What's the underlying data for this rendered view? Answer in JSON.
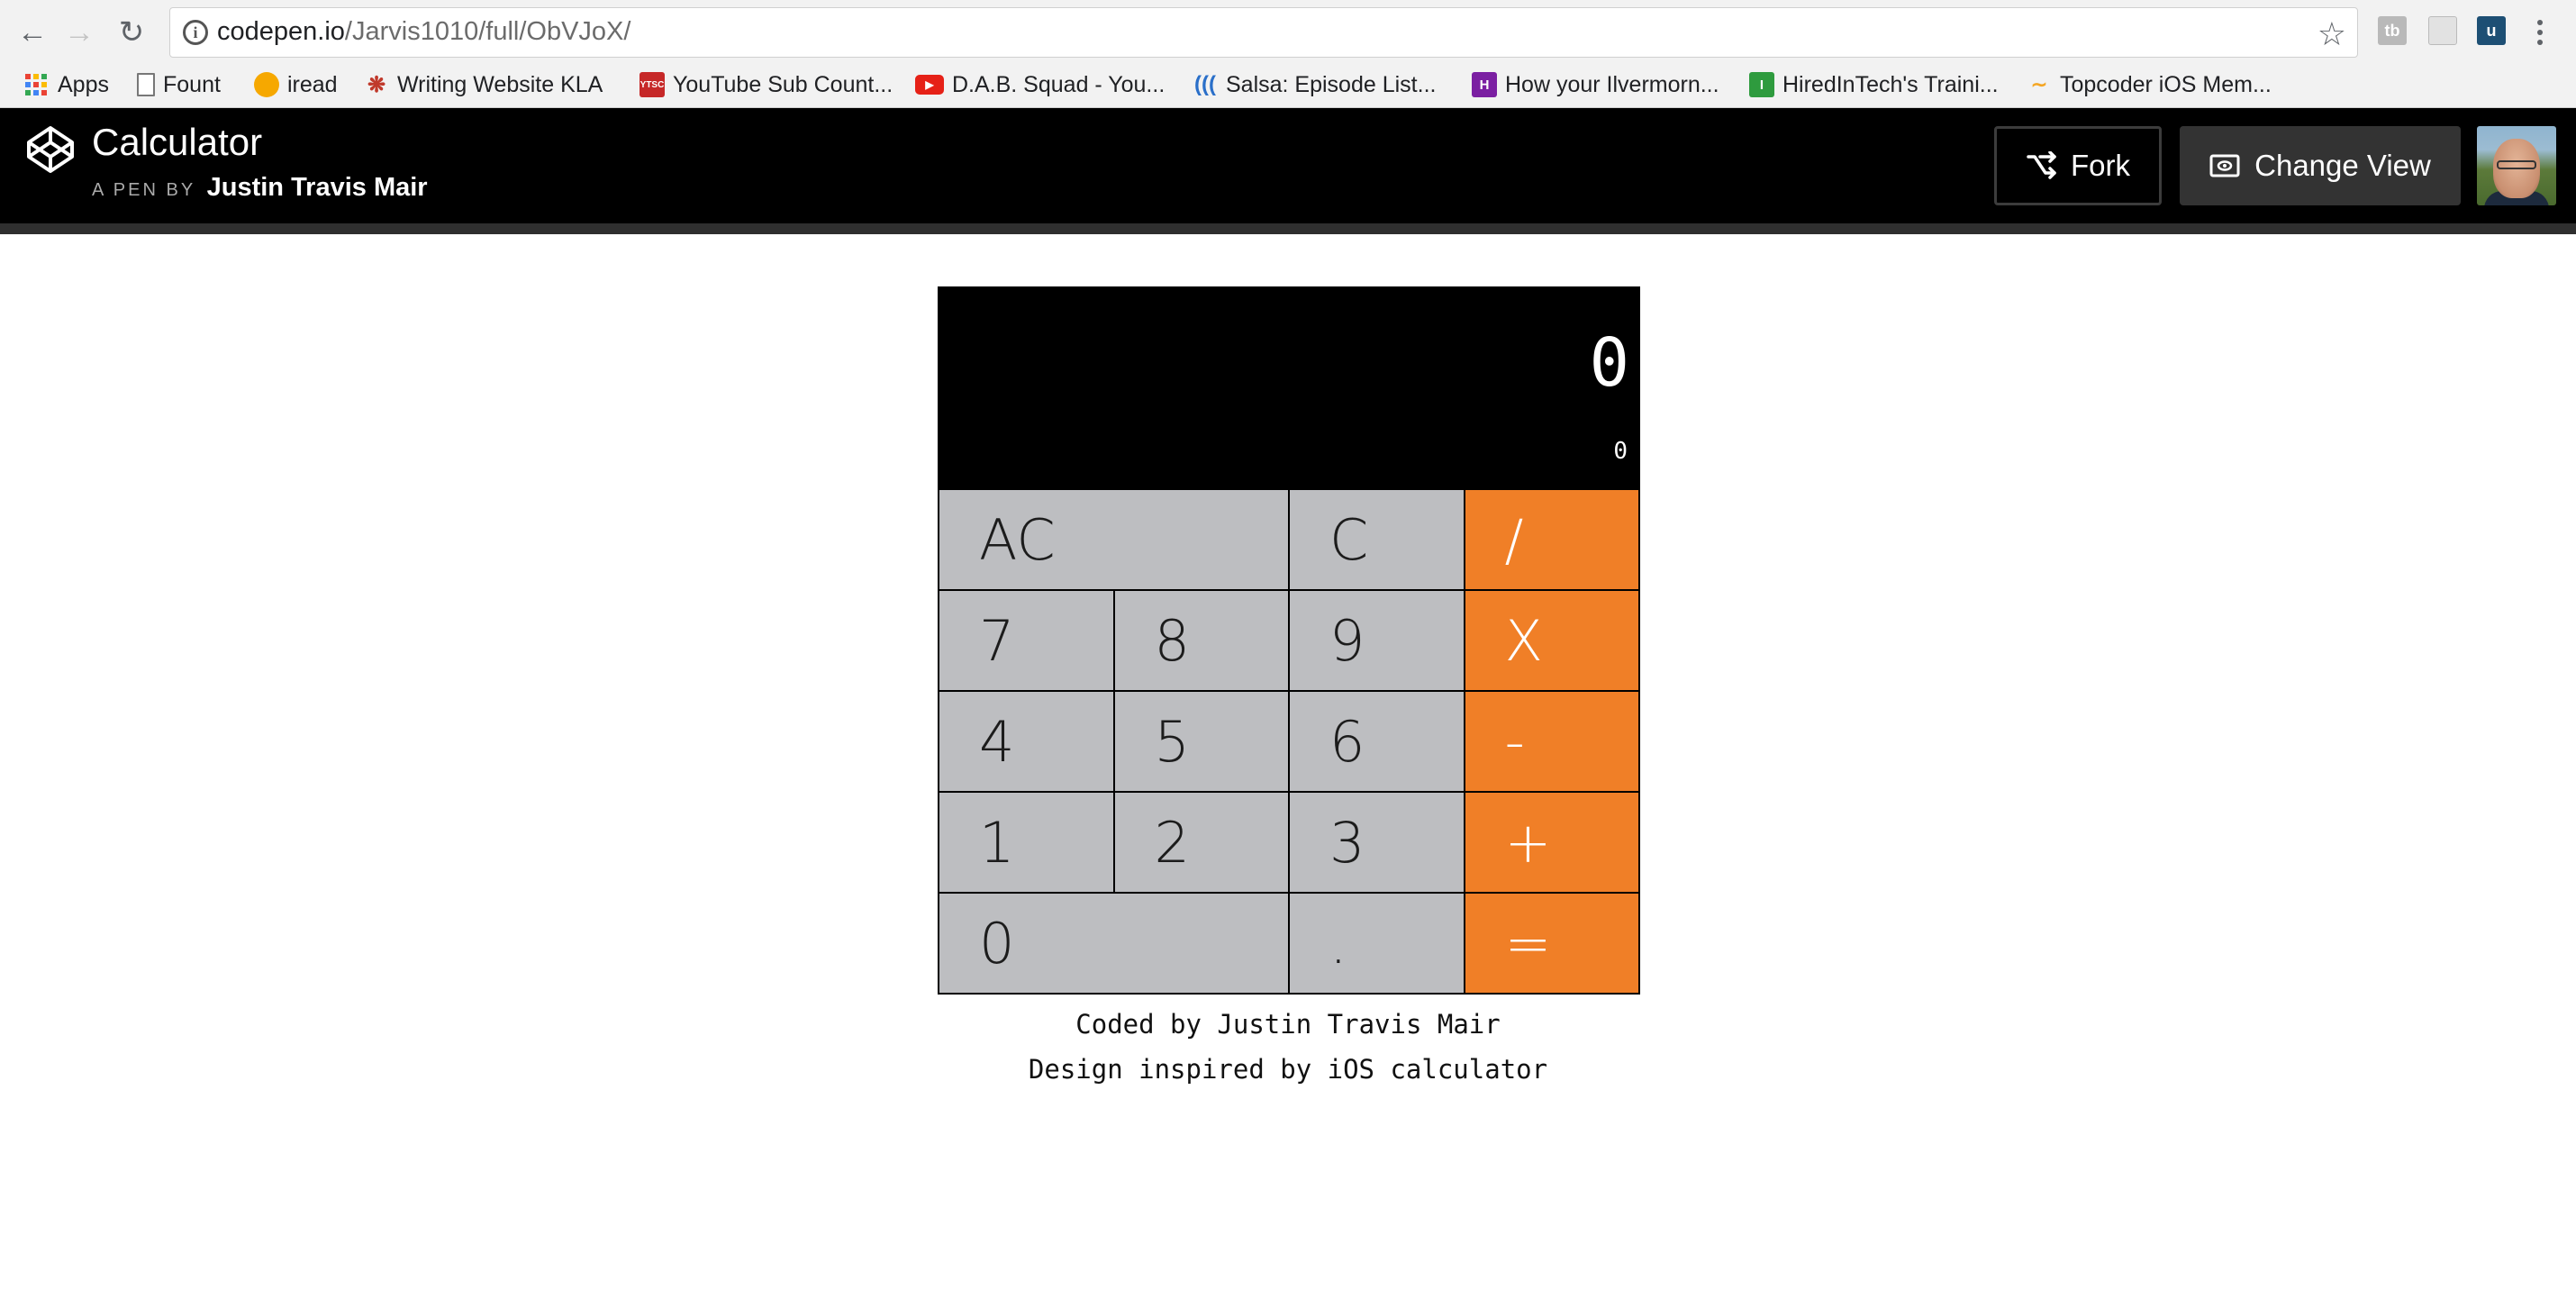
{
  "browser": {
    "url_host": "codepen.io",
    "url_path": "/Jarvis1010/full/ObVJoX/",
    "bookmarks": [
      {
        "label": "Apps",
        "icon": "apps-grid-icon"
      },
      {
        "label": "Fount",
        "icon": "page-icon"
      },
      {
        "label": "iread",
        "icon": "orange-dot-icon"
      },
      {
        "label": "Writing Website KLA",
        "icon": "bug-icon"
      },
      {
        "label": "YouTube Sub Count...",
        "icon": "ytsc-icon"
      },
      {
        "label": "D.A.B. Squad - You...",
        "icon": "youtube-icon"
      },
      {
        "label": "Salsa: Episode List...",
        "icon": "waves-icon"
      },
      {
        "label": "How your Ilvermorn...",
        "icon": "h-icon"
      },
      {
        "label": "HiredInTech's Traini...",
        "icon": "hiredintech-icon"
      },
      {
        "label": "Topcoder iOS Mem...",
        "icon": "topcoder-icon"
      }
    ]
  },
  "header": {
    "title": "Calculator",
    "byline_prefix": "A PEN BY",
    "author": "Justin Travis Mair",
    "fork_label": "Fork",
    "change_view_label": "Change View"
  },
  "calculator": {
    "display_main": "0",
    "display_sub": "0",
    "keys": [
      {
        "label": "AC",
        "name": "all-clear-button",
        "type": "num",
        "span": 2
      },
      {
        "label": "C",
        "name": "clear-button",
        "type": "num",
        "span": 1
      },
      {
        "label": "/",
        "name": "divide-button",
        "type": "op",
        "span": 1
      },
      {
        "label": "7",
        "name": "digit-7-button",
        "type": "num",
        "span": 1
      },
      {
        "label": "8",
        "name": "digit-8-button",
        "type": "num",
        "span": 1
      },
      {
        "label": "9",
        "name": "digit-9-button",
        "type": "num",
        "span": 1
      },
      {
        "label": "X",
        "name": "multiply-button",
        "type": "op",
        "span": 1
      },
      {
        "label": "4",
        "name": "digit-4-button",
        "type": "num",
        "span": 1
      },
      {
        "label": "5",
        "name": "digit-5-button",
        "type": "num",
        "span": 1
      },
      {
        "label": "6",
        "name": "digit-6-button",
        "type": "num",
        "span": 1
      },
      {
        "label": "-",
        "name": "subtract-button",
        "type": "op",
        "span": 1
      },
      {
        "label": "1",
        "name": "digit-1-button",
        "type": "num",
        "span": 1
      },
      {
        "label": "2",
        "name": "digit-2-button",
        "type": "num",
        "span": 1
      },
      {
        "label": "3",
        "name": "digit-3-button",
        "type": "num",
        "span": 1
      },
      {
        "label": "+",
        "name": "add-button",
        "type": "op",
        "span": 1
      },
      {
        "label": "0",
        "name": "digit-0-button",
        "type": "num",
        "span": 2
      },
      {
        "label": ".",
        "name": "decimal-button",
        "type": "num",
        "span": 1
      },
      {
        "label": "=",
        "name": "equals-button",
        "type": "op",
        "span": 1
      }
    ]
  },
  "footer": {
    "line1": "Coded by Justin Travis Mair",
    "line2": "Design inspired by iOS calculator"
  },
  "colors": {
    "operator_orange": "#f07f27",
    "key_gray": "#bdbec1",
    "display_black": "#000000"
  }
}
